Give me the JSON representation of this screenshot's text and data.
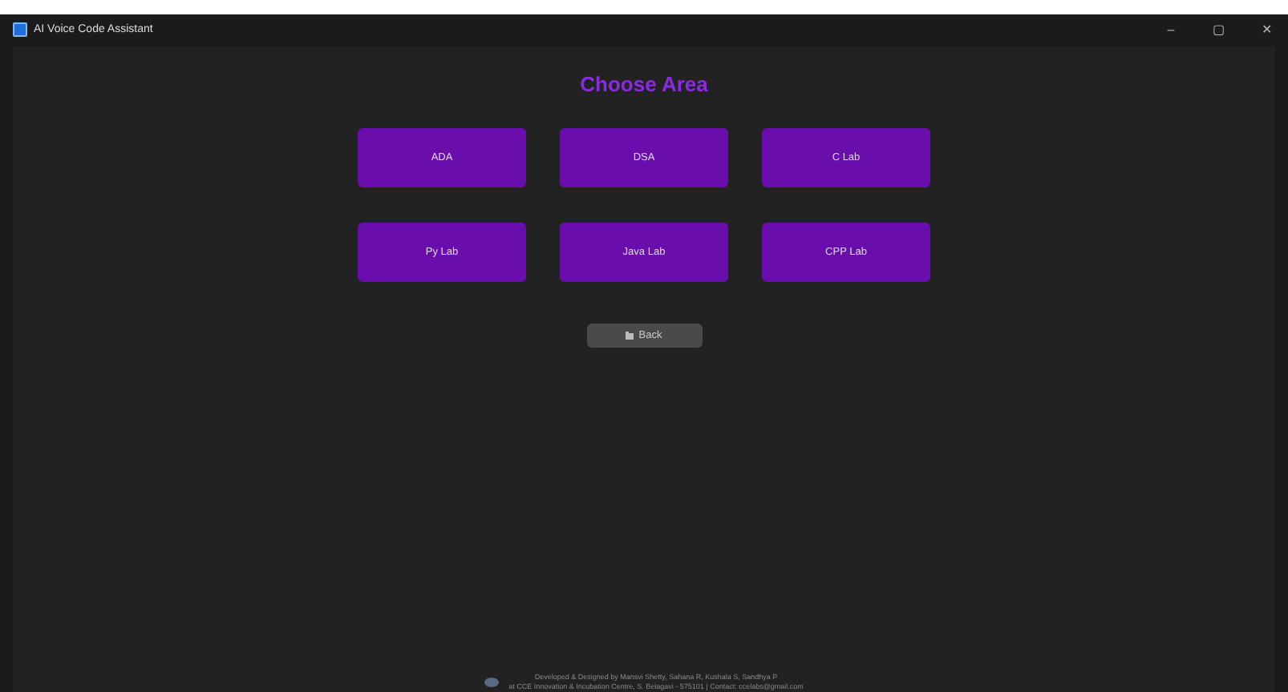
{
  "window": {
    "title": "AI Voice Code Assistant",
    "controls": [
      "–",
      "▢",
      "✕"
    ]
  },
  "heading": "Choose Area",
  "areas": [
    "ADA",
    "DSA",
    "C Lab",
    "Py Lab",
    "Java Lab",
    "CPP Lab"
  ],
  "back_button": {
    "label": "Back"
  },
  "footer": {
    "lines": [
      "Developed & Designed by Mansvi Shetty, Sahana R, Kushala S, Sandhya P",
      "at CCE Innovation & Incubation Centre, S. Belagavi - 575101 | Contact: ccelabs@gmail.com"
    ]
  }
}
